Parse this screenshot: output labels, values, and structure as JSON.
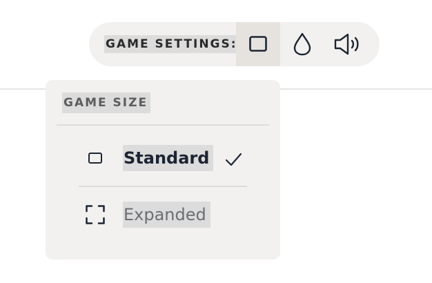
{
  "settings_bar": {
    "label": "GAME SETTINGS:",
    "buttons": [
      {
        "name": "game-size",
        "icon": "square-icon",
        "selected": true
      },
      {
        "name": "theme",
        "icon": "droplet-icon",
        "selected": false
      },
      {
        "name": "sound",
        "icon": "speaker-volume-icon",
        "selected": false
      }
    ]
  },
  "game_size_menu": {
    "heading": "GAME SIZE",
    "options": [
      {
        "label": "Standard",
        "icon": "square-icon",
        "selected": true,
        "indicator": "checkmark-icon"
      },
      {
        "label": "Expanded",
        "icon": "expand-corners-icon",
        "selected": false
      }
    ]
  },
  "colors": {
    "panel_background": "#f2f1ef",
    "selected_button_background": "#e6e3df",
    "text_highlight": "#dcdcdc",
    "dark_text": "#1c2433",
    "muted_text": "#6b6e72"
  }
}
